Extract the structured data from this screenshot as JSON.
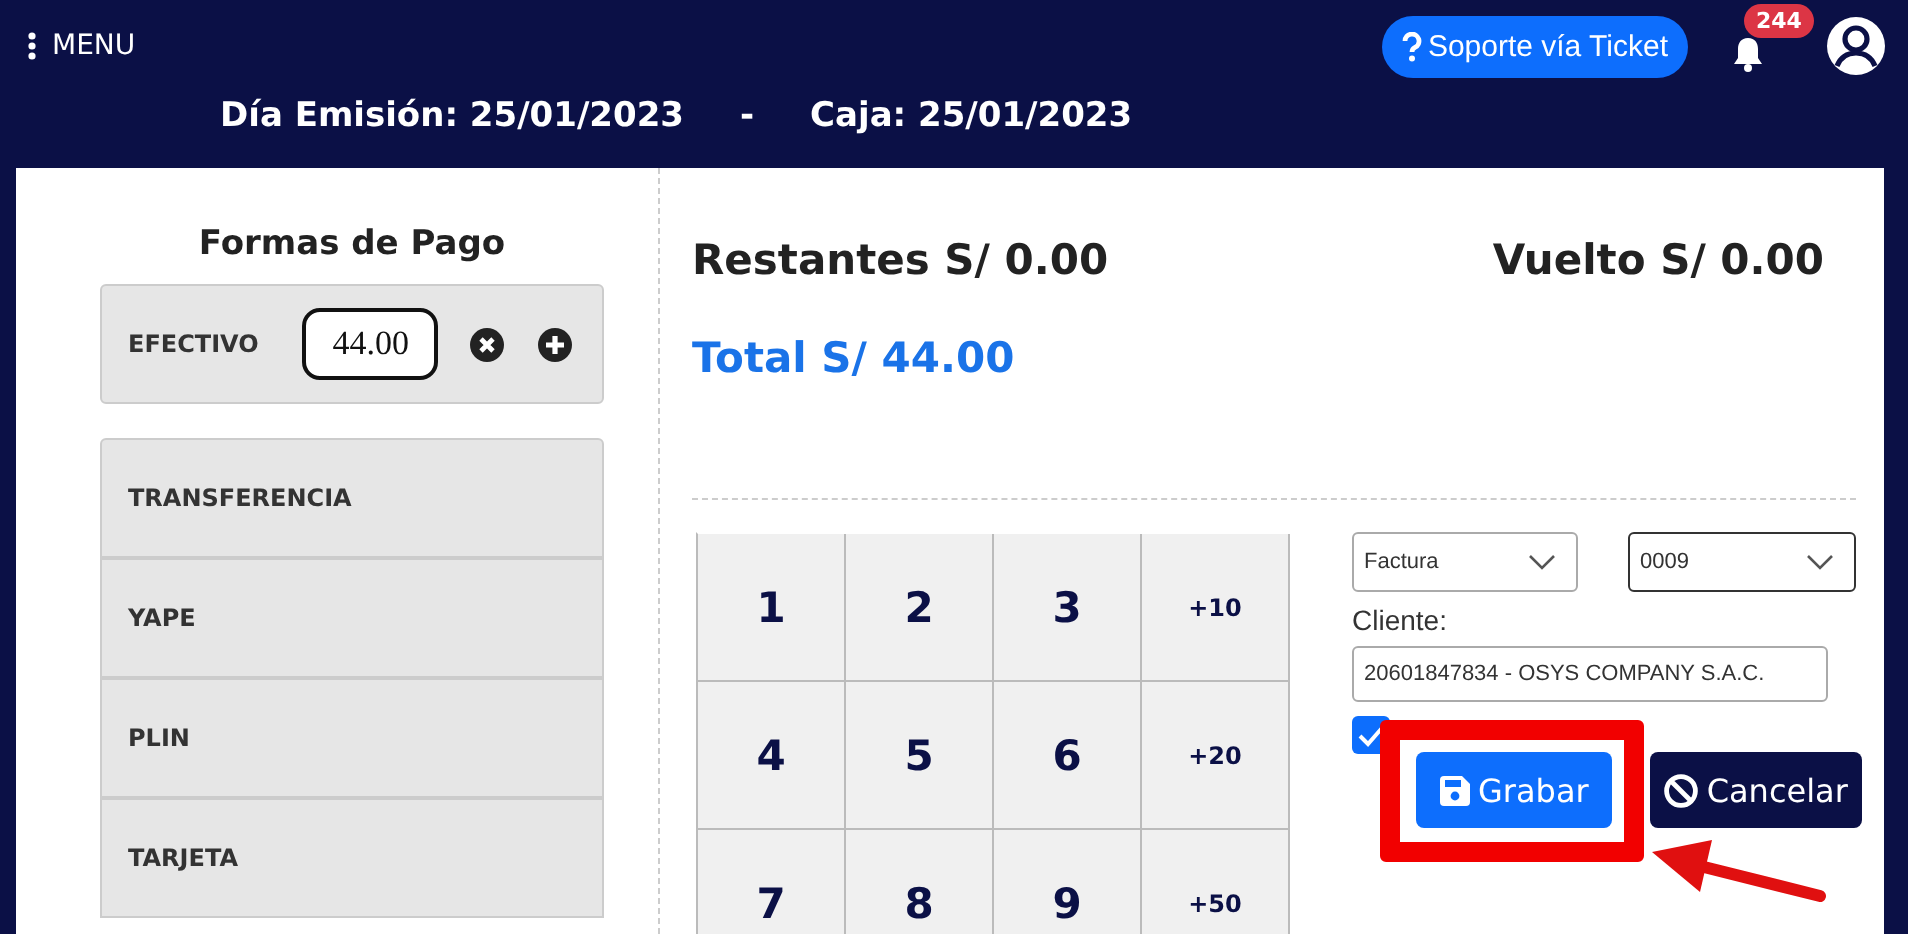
{
  "header": {
    "menu_label": "MENU",
    "support_button": "Soporte vía Ticket",
    "notification_count": "244",
    "issue_date": "Día Emisión: 25/01/2023",
    "separator": "-",
    "cash_date": "Caja: 25/01/2023"
  },
  "payment": {
    "title": "Formas de Pago",
    "methods": [
      {
        "name": "EFECTIVO",
        "kind": "active",
        "amount": "44.00"
      },
      {
        "name": "TRANSFERENCIA",
        "kind": "option"
      },
      {
        "name": "YAPE",
        "kind": "option"
      },
      {
        "name": "PLIN",
        "kind": "option"
      },
      {
        "name": "TARJETA",
        "kind": "option"
      }
    ]
  },
  "summary": {
    "remaining": "Restantes S/ 0.00",
    "change": "Vuelto S/ 0.00",
    "total": "Total S/ 44.00"
  },
  "keypad": {
    "keys": [
      "1",
      "2",
      "3",
      "+10",
      "4",
      "5",
      "6",
      "+20",
      "7",
      "8",
      "9",
      "+50"
    ]
  },
  "form": {
    "document_type": "Factura",
    "series": "0009",
    "client_label": "Cliente:",
    "client_value": "20601847834 - OSYS COMPANY S.A.C.",
    "checkbox": {
      "checked": true
    },
    "save_button": "Grabar",
    "cancel_button": "Cancelar"
  }
}
